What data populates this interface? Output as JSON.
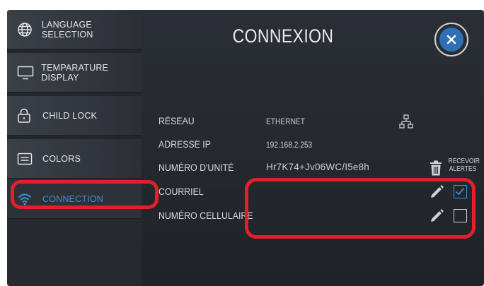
{
  "sidebar": {
    "items": [
      {
        "label": "LANGUAGE SELECTION",
        "icon": "globe-icon"
      },
      {
        "label": "TEMPARATURE DISPLAY",
        "icon": "monitor-icon"
      },
      {
        "label": "CHILD LOCK",
        "icon": "lock-icon"
      },
      {
        "label": "COLORS",
        "icon": "display-card-icon"
      },
      {
        "label": "CONNECTION",
        "icon": "wifi-icon",
        "active": true
      }
    ]
  },
  "header": {
    "title": "CONNEXION"
  },
  "fields": {
    "network": {
      "label": "RÉSEAU",
      "value": "ETHERNET"
    },
    "ip": {
      "label": "ADRESSE IP",
      "value": "192.168.2.253"
    },
    "unit": {
      "label": "NUMÉRO D'UNITÉ",
      "value": "Hr7K74+Jv06WC/I5e8h"
    },
    "email": {
      "label": "COURRIEL",
      "value": "",
      "receive_alerts": true
    },
    "cell": {
      "label": "NUMÉRO CELLULAIRE",
      "value": "",
      "receive_alerts": false
    }
  },
  "alerts": {
    "label_line1": "RECEVOIR",
    "label_line2": "ALERTES"
  },
  "colors": {
    "accent": "#2f6fb5",
    "active_text": "#3f8ed8",
    "highlight": "#e2202b"
  }
}
